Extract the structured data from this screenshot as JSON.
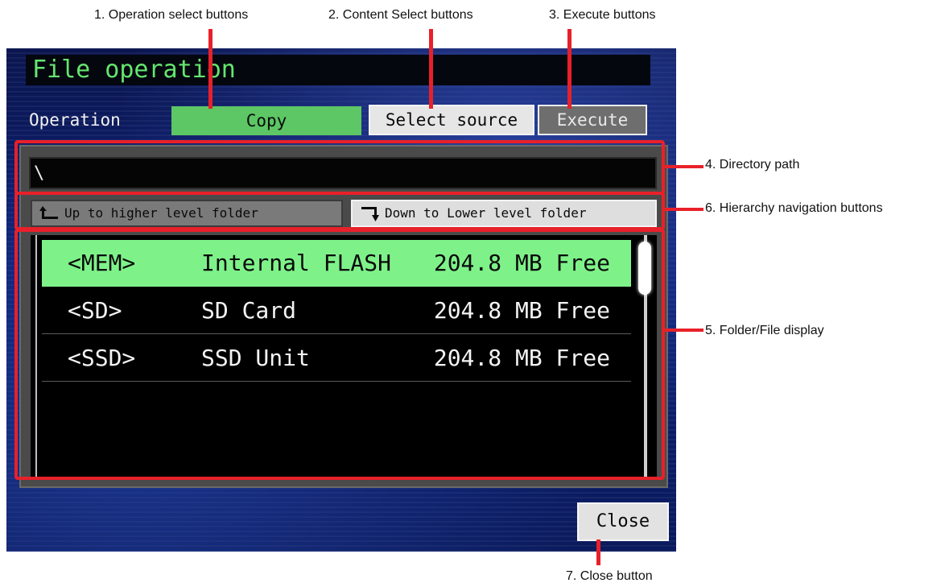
{
  "callouts": {
    "operation_select": "1. Operation select buttons",
    "content_select": "2. Content Select buttons",
    "execute": "3. Execute buttons",
    "directory_path": "4. Directory path",
    "folder_file_display": "5. Folder/File display",
    "hierarchy_nav": "6. Hierarchy navigation buttons",
    "close": "7. Close button"
  },
  "dialog": {
    "title": "File operation",
    "operation_label": "Operation",
    "operation_value": "Copy",
    "select_source_label": "Select source",
    "execute_label": "Execute",
    "path": "\\",
    "nav": {
      "up_label": "Up to higher level folder",
      "down_label": "Down to Lower level folder"
    },
    "items": [
      {
        "tag": "<MEM>",
        "name": "Internal FLASH",
        "free": "204.8 MB Free",
        "selected": true
      },
      {
        "tag": "<SD>",
        "name": "SD Card",
        "free": "204.8 MB Free",
        "selected": false
      },
      {
        "tag": "<SSD>",
        "name": "SSD Unit",
        "free": "204.8 MB Free",
        "selected": false
      }
    ],
    "close_label": "Close"
  },
  "icons": {
    "up": "arrow-up-left-icon",
    "down": "arrow-down-right-icon"
  },
  "colors": {
    "title_green": "#64e66e",
    "copy_button": "#5cc764",
    "selected_row": "#7ef289",
    "callout_red": "#e8202a"
  }
}
